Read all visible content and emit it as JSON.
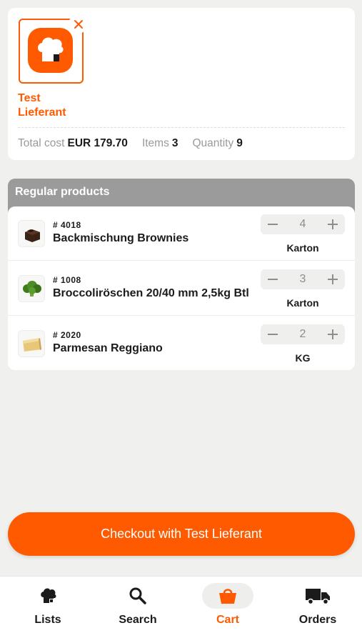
{
  "colors": {
    "accent": "#ff5a00",
    "section_header": "#9b9b9b",
    "background": "#f0f0ee"
  },
  "supplier": {
    "name_line1": "Test",
    "name_line2": "Lieferant",
    "logo_icon": "chef-hat-icon",
    "remove_icon": "close-icon"
  },
  "summary": {
    "total_cost_label": "Total cost",
    "total_cost_value": "EUR 179.70",
    "items_label": "Items",
    "items_value": "3",
    "quantity_label": "Quantity",
    "quantity_value": "9"
  },
  "section": {
    "title": "Regular products"
  },
  "products": [
    {
      "sku": "# 4018",
      "name": "Backmischung Brownies",
      "qty": "4",
      "unit": "Karton",
      "image_icon": "brownie-icon"
    },
    {
      "sku": "# 1008",
      "name": "Broccoliröschen 20/40 mm 2,5kg Btl",
      "qty": "3",
      "unit": "Karton",
      "image_icon": "broccoli-icon"
    },
    {
      "sku": "# 2020",
      "name": "Parmesan Reggiano",
      "qty": "2",
      "unit": "KG",
      "image_icon": "cheese-icon"
    }
  ],
  "checkout": {
    "label": "Checkout with Test Lieferant"
  },
  "nav": {
    "items": [
      {
        "label": "Lists",
        "icon": "chef-hat-icon",
        "active": false
      },
      {
        "label": "Search",
        "icon": "search-icon",
        "active": false
      },
      {
        "label": "Cart",
        "icon": "shopping-bag-icon",
        "active": true
      },
      {
        "label": "Orders",
        "icon": "truck-icon",
        "active": false
      }
    ]
  }
}
